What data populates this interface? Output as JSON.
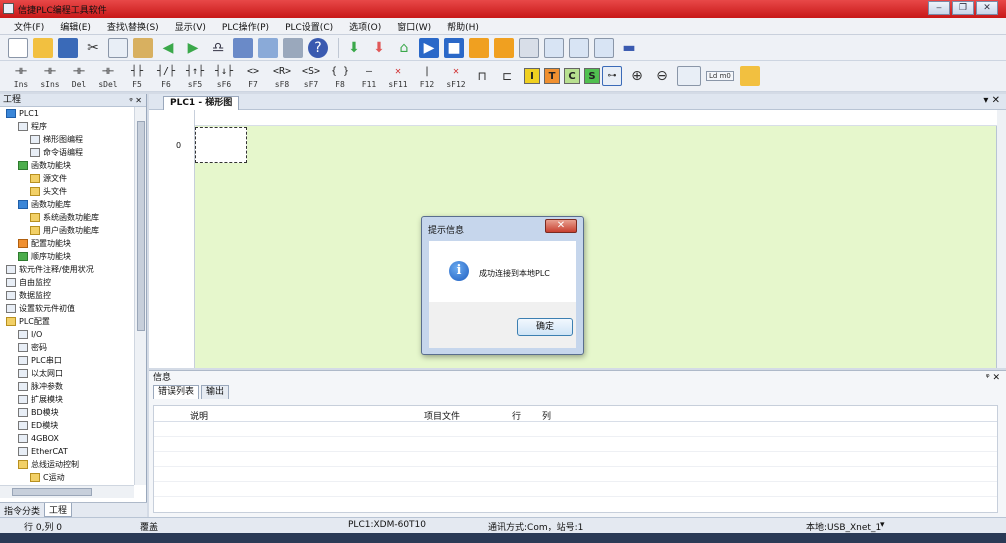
{
  "window": {
    "title": "信捷PLC编程工具软件",
    "controls": [
      "‒",
      "❐",
      "✕"
    ]
  },
  "menu": [
    "文件(F)",
    "编辑(E)",
    "查找\\替换(S)",
    "显示(V)",
    "PLC操作(P)",
    "PLC设置(C)",
    "选项(O)",
    "窗口(W)",
    "帮助(H)"
  ],
  "toolbar_ladder": {
    "buttons": [
      {
        "sym": "⊣⊢",
        "label": "Ins"
      },
      {
        "sym": "⊣⊢",
        "label": "sIns"
      },
      {
        "sym": "⊣⊢",
        "label": "Del"
      },
      {
        "sym": "⊣⊢",
        "label": "sDel"
      },
      {
        "sym": "┤├",
        "label": "F5"
      },
      {
        "sym": "┤/├",
        "label": "F6"
      },
      {
        "sym": "┤↑├",
        "label": "sF5"
      },
      {
        "sym": "┤↓├",
        "label": "sF6"
      },
      {
        "sym": "<>",
        "label": "F7"
      },
      {
        "sym": "<R>",
        "label": "sF8"
      },
      {
        "sym": "<S>",
        "label": "sF7"
      },
      {
        "sym": "{ }",
        "label": "F8"
      },
      {
        "sym": "—",
        "label": "F11"
      },
      {
        "sym": "✕",
        "label": "sF11"
      },
      {
        "sym": "|",
        "label": "F12"
      },
      {
        "sym": "✕",
        "label": "sF12"
      }
    ],
    "blocks": [
      "I",
      "T",
      "C",
      "S"
    ],
    "ld_label": "Ld m0"
  },
  "project_panel": {
    "title": "工程",
    "tree": [
      {
        "level": 0,
        "icon": "plc",
        "label": "PLC1"
      },
      {
        "level": 1,
        "icon": "program",
        "label": "程序"
      },
      {
        "level": 2,
        "icon": "ladder",
        "label": "梯形图编程"
      },
      {
        "level": 2,
        "icon": "ld",
        "label": "命令语编程"
      },
      {
        "level": 1,
        "icon": "green",
        "label": "函数功能块"
      },
      {
        "level": 2,
        "icon": "folder",
        "label": "源文件"
      },
      {
        "level": 2,
        "icon": "folder",
        "label": "头文件"
      },
      {
        "level": 1,
        "icon": "blue",
        "label": "函数功能库"
      },
      {
        "level": 2,
        "icon": "folder",
        "label": "系统函数功能库"
      },
      {
        "level": 2,
        "icon": "folder",
        "label": "用户函数功能库"
      },
      {
        "level": 1,
        "icon": "orange",
        "label": "配置功能块"
      },
      {
        "level": 1,
        "icon": "green",
        "label": "顺序功能块"
      },
      {
        "level": 0,
        "icon": "doc",
        "label": "软元件注释/使用状况"
      },
      {
        "level": 0,
        "icon": "doc",
        "label": "自由监控"
      },
      {
        "level": 0,
        "icon": "doc",
        "label": "数据监控"
      },
      {
        "level": 0,
        "icon": "doc",
        "label": "设置软元件初值"
      },
      {
        "level": 0,
        "icon": "folder",
        "label": "PLC配置"
      },
      {
        "level": 1,
        "icon": "io",
        "label": "I/O"
      },
      {
        "level": 1,
        "icon": "pw",
        "label": "密码"
      },
      {
        "level": 1,
        "icon": "port",
        "label": "PLC串口"
      },
      {
        "level": 1,
        "icon": "eth",
        "label": "以太网口"
      },
      {
        "level": 1,
        "icon": "pulse",
        "label": "脉冲参数"
      },
      {
        "level": 1,
        "icon": "ext",
        "label": "扩展模块"
      },
      {
        "level": 1,
        "icon": "bd",
        "label": "BD模块"
      },
      {
        "level": 1,
        "icon": "ed",
        "label": "ED模块"
      },
      {
        "level": 1,
        "icon": "box",
        "label": "4GBOX"
      },
      {
        "level": 1,
        "icon": "ecat",
        "label": "EtherCAT"
      },
      {
        "level": 1,
        "icon": "folder",
        "label": "总线运动控制"
      },
      {
        "level": 2,
        "icon": "folder",
        "label": "C运动"
      }
    ],
    "tabs": [
      "指令分类",
      "工程"
    ]
  },
  "document": {
    "tab_label": "PLC1 - 梯形图",
    "rung_number": "0"
  },
  "output_panel": {
    "title": "信息",
    "tabs": [
      "错误列表",
      "输出"
    ],
    "columns": [
      "说明",
      "项目文件",
      "行",
      "列"
    ]
  },
  "dialog": {
    "title": "提示信息",
    "message": "成功连接到本地PLC",
    "ok_label": "确定",
    "close_label": "✕"
  },
  "status": {
    "position": "行 0,列 0",
    "mode": "覆盖",
    "plc_model": "PLC1:XDM-60T10",
    "comm": "通讯方式:Com，站号:1",
    "connection": "本地:USB_Xnet_1"
  }
}
